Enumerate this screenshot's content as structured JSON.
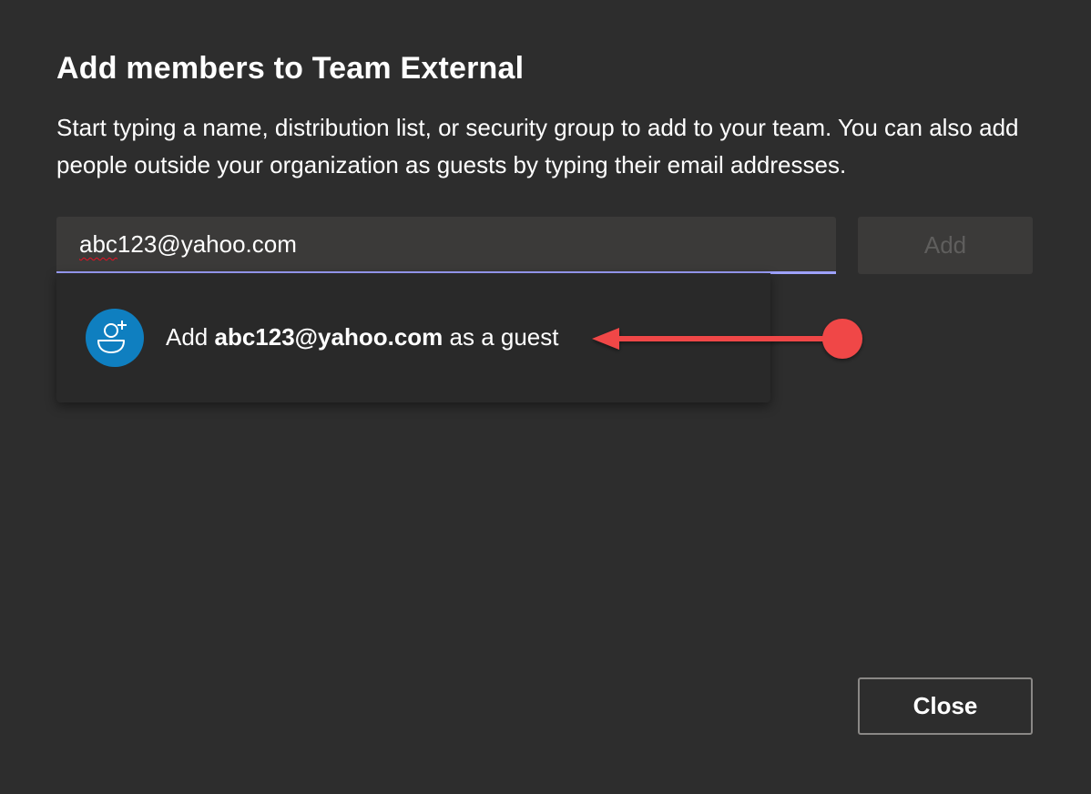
{
  "dialog": {
    "title": "Add members to Team External",
    "description": "Start typing a name, distribution list, or security group to add to your team. You can also add people outside your organization as guests by typing their email addresses."
  },
  "input": {
    "value_misspelled": "abc",
    "value_rest": "123@yahoo.com"
  },
  "add_button": {
    "label": "Add",
    "enabled": false
  },
  "suggestion": {
    "prefix": "Add ",
    "email": "abc123@yahoo.com",
    "suffix": " as a guest",
    "icon": "add-guest-icon"
  },
  "annotation": {
    "color": "#f04747",
    "icon": "red-arrow-pointer"
  },
  "close_button": {
    "label": "Close"
  },
  "colors": {
    "background": "#2d2d2d",
    "input_background": "#3b3a39",
    "input_focus_underline": "#9ea2ff",
    "avatar": "#0f7fc0",
    "disabled_text": "#5f5e5d"
  }
}
